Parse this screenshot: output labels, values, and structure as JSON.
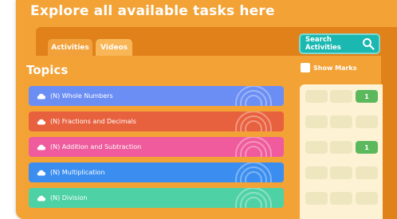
{
  "page": {
    "heading": "Explore all available tasks here"
  },
  "tabs": [
    {
      "label": "Activities"
    },
    {
      "label": "Videos"
    }
  ],
  "search": {
    "label": "Search Activities",
    "icon": "search-icon"
  },
  "topics": {
    "title": "Topics",
    "show_marks_label": "Show Marks",
    "items": [
      {
        "label": "(N) Whole Numbers",
        "color": "#6b8ef5",
        "mark": "1"
      },
      {
        "label": "(N) Fractions and Decimals",
        "color": "#e8613e",
        "mark": ""
      },
      {
        "label": "(N) Addition and Subtraction",
        "color": "#ef5b9c",
        "mark": "1"
      },
      {
        "label": "(N) Multiplication",
        "color": "#3b8ef0",
        "mark": ""
      },
      {
        "label": "(N) Division",
        "color": "#4fd1a6",
        "mark": ""
      }
    ]
  },
  "colors": {
    "frame": "#f3a236",
    "panel": "#e0811a",
    "search": "#1ab8b0",
    "marks_bg": "#fdf3d4",
    "mark_done": "#5cb85c"
  }
}
